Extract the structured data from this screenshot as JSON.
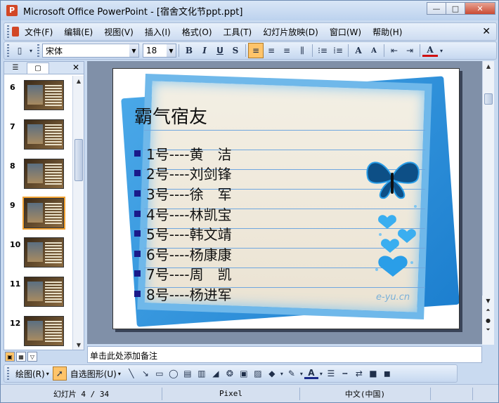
{
  "window": {
    "title": "Microsoft Office PowerPoint - [宿舍文化节ppt.ppt]"
  },
  "window_buttons": {
    "minimize": "—",
    "restore": "□",
    "close": "✕"
  },
  "menu": [
    "文件(F)",
    "编辑(E)",
    "视图(V)",
    "插入(I)",
    "格式(O)",
    "工具(T)",
    "幻灯片放映(D)",
    "窗口(W)",
    "帮助(H)"
  ],
  "toolbar": {
    "font_name": "宋体",
    "font_size": "18",
    "bold": "B",
    "italic": "I",
    "underline": "U",
    "shadow": "S",
    "grow_font": "A",
    "shrink_font": "A",
    "font_color": "A"
  },
  "thumbnails": [
    {
      "num": "6"
    },
    {
      "num": "7"
    },
    {
      "num": "8"
    },
    {
      "num": "9"
    },
    {
      "num": "10"
    },
    {
      "num": "11"
    },
    {
      "num": "12"
    }
  ],
  "slide": {
    "title": "霸气宿友",
    "bullets": [
      "1号----黄　洁",
      "2号----刘剑锋",
      "3号----徐　军",
      "4号----林凯宝",
      "5号----韩文靖",
      "6号----杨康康",
      "7号----周　凯",
      "8号----杨进军"
    ],
    "watermark": "e-yu.cn"
  },
  "notes": {
    "placeholder": "单击此处添加备注"
  },
  "drawbar": {
    "draw_label": "绘图(R)",
    "autoshapes_label": "自选图形(U)"
  },
  "status": {
    "slide": "幻灯片 4 / 34",
    "design": "Pixel",
    "language": "中文(中国)"
  },
  "colors": {
    "bullet": "#1a1a8a",
    "card_border": "#6fb8ea",
    "card_back": "#1c7fcf",
    "active_button": "#ffc46a"
  }
}
